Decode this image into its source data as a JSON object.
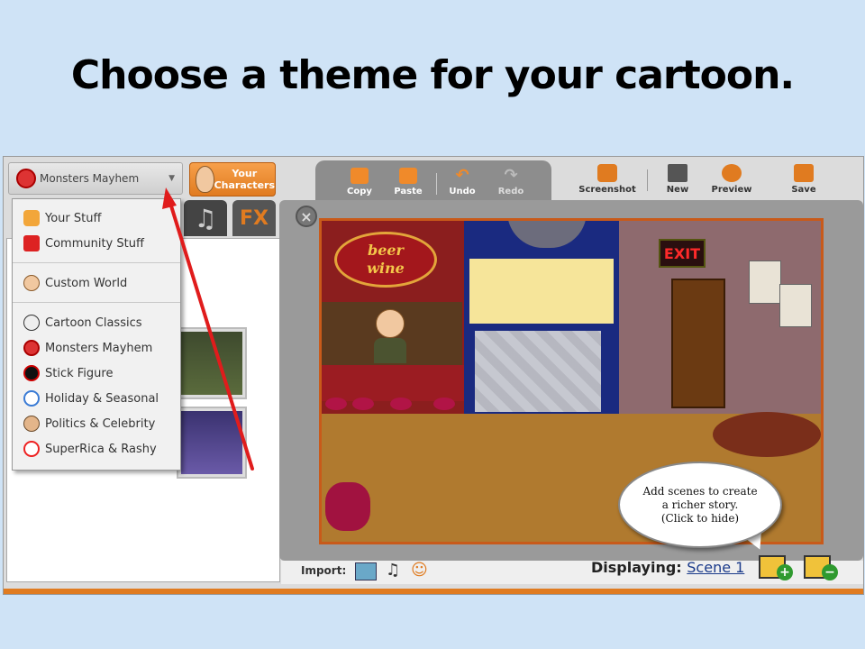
{
  "slide": {
    "title": "Choose a theme for your cartoon."
  },
  "theme_select": {
    "value": "Monsters Mayhem",
    "icon": "monster-icon"
  },
  "your_characters": {
    "label_line1": "Your",
    "label_line2": "Characters"
  },
  "tabs": {
    "fx_label": "FX"
  },
  "dropdown": {
    "items": [
      {
        "label": "Your Stuff",
        "icon": "person-icon"
      },
      {
        "label": "Community Stuff",
        "icon": "people-icon"
      },
      {
        "label": "Custom World",
        "icon": "face-icon"
      },
      {
        "label": "Cartoon Classics",
        "icon": "classic-face-icon"
      },
      {
        "label": "Monsters Mayhem",
        "icon": "monster-icon"
      },
      {
        "label": "Stick Figure",
        "icon": "stick-figure-icon"
      },
      {
        "label": "Holiday & Seasonal",
        "icon": "snowman-icon"
      },
      {
        "label": "Politics & Celebrity",
        "icon": "politician-icon"
      },
      {
        "label": "SuperRica & Rashy",
        "icon": "superrica-icon"
      }
    ]
  },
  "toolbar": {
    "copy": "Copy",
    "paste": "Paste",
    "undo": "Undo",
    "redo": "Redo",
    "screenshot": "Screenshot",
    "new": "New",
    "preview": "Preview",
    "save": "Save"
  },
  "scene": {
    "bar_sign_line1": "beer",
    "bar_sign_line2": "wine",
    "exit_sign": "EXIT"
  },
  "bubble": {
    "line1": "Add scenes to create",
    "line2": "a richer story.",
    "line3": "(Click to hide)"
  },
  "bottom": {
    "import_label": "Import:",
    "displaying_label": "Displaying:",
    "scene_link": "Scene 1"
  },
  "colors": {
    "slide_bg": "#cfe3f6",
    "accent_orange": "#e07b20",
    "arrow_red": "#e01c1c"
  }
}
